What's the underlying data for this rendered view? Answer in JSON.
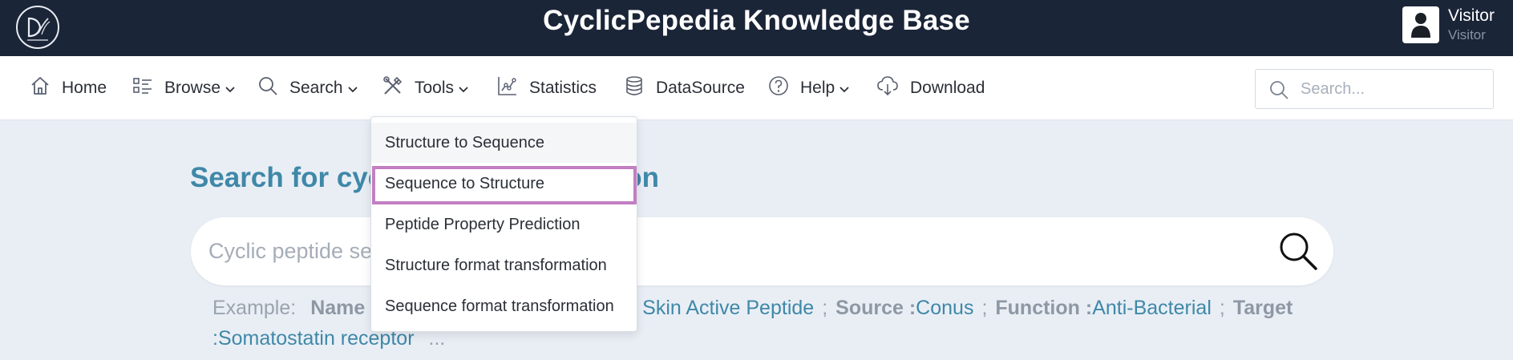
{
  "header": {
    "title": "CyclicPepedia Knowledge Base",
    "user": {
      "name": "Visitor",
      "role": "Visitor"
    }
  },
  "nav": {
    "items": [
      {
        "label": "Home",
        "icon": "home-icon"
      },
      {
        "label": "Browse",
        "icon": "list-icon",
        "dropdown": true
      },
      {
        "label": "Search",
        "icon": "search-icon",
        "dropdown": true
      },
      {
        "label": "Tools",
        "icon": "tools-icon",
        "dropdown": true
      },
      {
        "label": "Statistics",
        "icon": "chart-icon"
      },
      {
        "label": "DataSource",
        "icon": "database-icon"
      },
      {
        "label": "Help",
        "icon": "help-icon",
        "dropdown": true
      },
      {
        "label": "Download",
        "icon": "cloud-download-icon"
      }
    ],
    "search_placeholder": "Search..."
  },
  "tools_menu": {
    "items": [
      "Structure to Sequence",
      "Sequence to Structure",
      "Peptide Property Prediction",
      "Structure format transformation",
      "Sequence format transformation"
    ],
    "highlighted_index": 1
  },
  "main": {
    "title_visible": "Search for cyc",
    "title_tail": "on",
    "search_placeholder": "Cyclic peptide se",
    "example_label": "Example:",
    "examples": [
      {
        "key": "Name",
        "value": "g Skin Active Peptide"
      },
      {
        "key": "Source :",
        "value": "Conus"
      },
      {
        "key": "Function :",
        "value": "Anti-Bacterial"
      },
      {
        "key": "Target",
        "value": ":Somatostatin receptor"
      }
    ],
    "ellipsis": "..."
  },
  "colors": {
    "header_bg": "#1b2538",
    "accent": "#3f88a8",
    "highlight": "#c27fc2"
  }
}
